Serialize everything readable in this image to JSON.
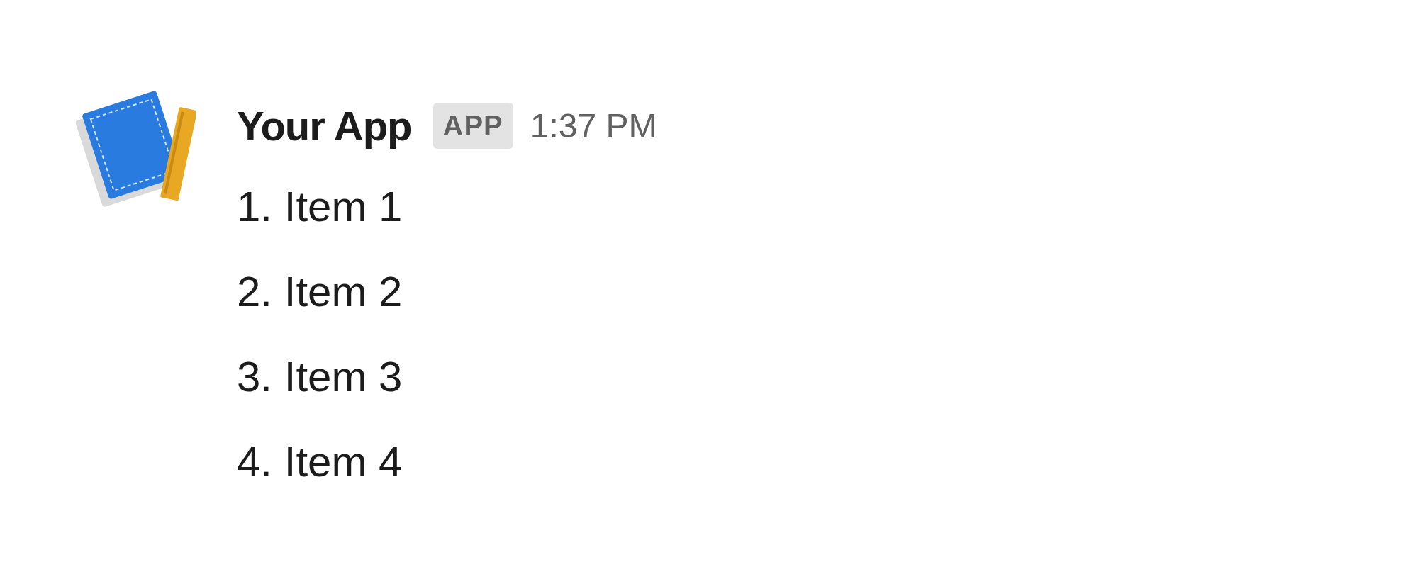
{
  "message": {
    "sender": "Your App",
    "badge": "APP",
    "time": "1:37 PM",
    "lines": [
      "1. Item 1",
      "2. Item 2",
      "3. Item 3",
      "4. Item 4"
    ]
  }
}
